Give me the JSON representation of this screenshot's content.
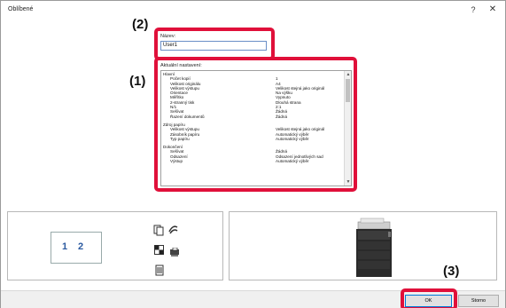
{
  "window": {
    "title": "Oblíbené",
    "help_glyph": "?",
    "close_glyph": "✕"
  },
  "callouts": {
    "one": "(1)",
    "two": "(2)",
    "three": "(3)"
  },
  "name_field": {
    "label": "Název:",
    "value": "User1"
  },
  "settings": {
    "label": "Aktuální nastavení:",
    "sections": [
      {
        "header": "Hlavní",
        "rows": [
          {
            "key": "Počet kopií",
            "value": "1"
          },
          {
            "key": "Velikost originálu",
            "value": "A4"
          },
          {
            "key": "Velikost výstupu",
            "value": "Velikost stejná jako originál"
          },
          {
            "key": "Orientace",
            "value": "Na výšku"
          },
          {
            "key": "Měřítko",
            "value": "Vypnuto"
          },
          {
            "key": "2-stranný tisk",
            "value": "Dlouhá strana"
          },
          {
            "key": "N/1",
            "value": "2:1"
          },
          {
            "key": "Sešívat",
            "value": "Žádná"
          },
          {
            "key": "Řazení dokumentů",
            "value": "Žádná"
          }
        ]
      },
      {
        "header": "Zdroj papíru",
        "rows": [
          {
            "key": "Velikost výstupu",
            "value": "Velikost stejná jako originál"
          },
          {
            "key": "Zásobník papíru",
            "value": "Automatický výběr"
          },
          {
            "key": "Typ papíru",
            "value": "Automatický výběr"
          }
        ]
      },
      {
        "header": "Dokončení",
        "rows": [
          {
            "key": "Sešívat",
            "value": "Žádná"
          },
          {
            "key": "Odsazení",
            "value": "Odsazení jednotlivých sad"
          },
          {
            "key": "Výstup",
            "value": "Automatický výběr"
          }
        ]
      }
    ],
    "scroll_up": "▲",
    "scroll_down": "▼"
  },
  "preview": {
    "page_numbers": [
      "1",
      "2"
    ]
  },
  "buttons": {
    "ok": "OK",
    "cancel": "Storno"
  },
  "colors": {
    "callout_border": "#e0103a",
    "preview_numbers": "#2c5aa0"
  }
}
